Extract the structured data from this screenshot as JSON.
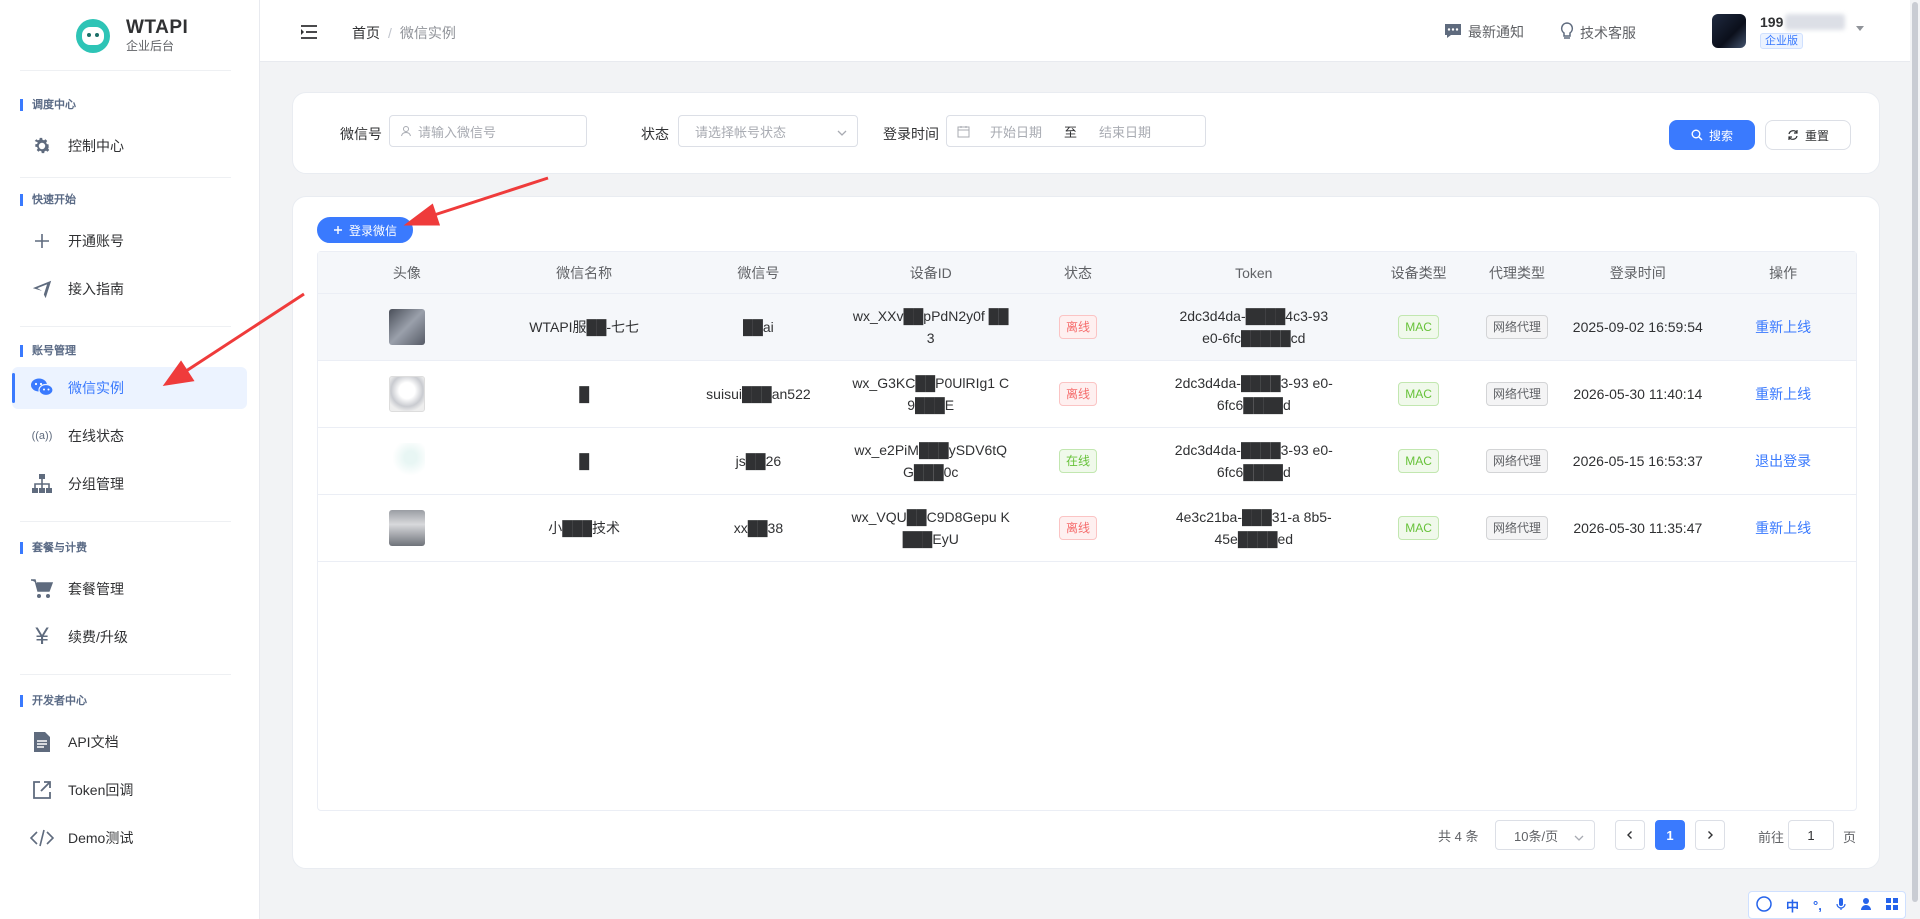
{
  "brand": {
    "title": "WTAPI",
    "subtitle": "企业后台"
  },
  "sidebar": {
    "sections": [
      {
        "title": "调度中心",
        "items": [
          {
            "label": "控制中心",
            "icon": "gear-icon"
          }
        ]
      },
      {
        "title": "快速开始",
        "items": [
          {
            "label": "开通账号",
            "icon": "plus-icon"
          },
          {
            "label": "接入指南",
            "icon": "send-icon"
          }
        ]
      },
      {
        "title": "账号管理",
        "items": [
          {
            "label": "微信实例",
            "icon": "wechat-icon",
            "active": true
          },
          {
            "label": "在线状态",
            "icon": "signal-icon"
          },
          {
            "label": "分组管理",
            "icon": "org-chart-icon"
          }
        ]
      },
      {
        "title": "套餐与计费",
        "items": [
          {
            "label": "套餐管理",
            "icon": "cart-icon"
          },
          {
            "label": "续费/升级",
            "icon": "yen-icon"
          }
        ]
      },
      {
        "title": "开发者中心",
        "items": [
          {
            "label": "API文档",
            "icon": "document-icon"
          },
          {
            "label": "Token回调",
            "icon": "external-link-icon"
          },
          {
            "label": "Demo测试",
            "icon": "code-icon"
          }
        ]
      }
    ]
  },
  "header": {
    "breadcrumb": {
      "home": "首页",
      "sep": "/",
      "current": "微信实例"
    },
    "notify": "最新通知",
    "support": "技术客服",
    "user": {
      "name": "199",
      "tag": "企业版"
    }
  },
  "filter": {
    "wechat_label": "微信号",
    "wechat_placeholder": "请输入微信号",
    "status_label": "状态",
    "status_placeholder": "请选择帐号状态",
    "time_label": "登录时间",
    "start_placeholder": "开始日期",
    "to": "至",
    "end_placeholder": "结束日期",
    "search": "搜索",
    "reset": "重置"
  },
  "table": {
    "login_button": "登录微信",
    "columns": [
      "头像",
      "微信名称",
      "微信号",
      "设备ID",
      "状态",
      "Token",
      "设备类型",
      "代理类型",
      "登录时间",
      "操作"
    ],
    "rows": [
      {
        "name": "WTAPI服██-七七",
        "wxid": "██ai",
        "device": "wx_XXv██pPdN2y0f ██3",
        "status": "离线",
        "status_type": "off",
        "token": "2dc3d4da-████4c3-93 e0-6fc█████cd",
        "device_type": "MAC",
        "proxy": "网络代理",
        "time": "2025-09-02 16:59:54",
        "action": "重新上线",
        "highlight": true
      },
      {
        "name": "█",
        "wxid": "suisui███an522",
        "device": "wx_G3KC██P0UlRIg1 C9███E",
        "status": "离线",
        "status_type": "off",
        "token": "2dc3d4da-████3-93 e0-6fc6████d",
        "device_type": "MAC",
        "proxy": "网络代理",
        "time": "2026-05-30 11:40:14",
        "action": "重新上线",
        "highlight": false
      },
      {
        "name": "█",
        "wxid": "js██26",
        "device": "wx_e2PiM███ySDV6tQ G███0c",
        "status": "在线",
        "status_type": "on",
        "token": "2dc3d4da-████3-93 e0-6fc6████d",
        "device_type": "MAC",
        "proxy": "网络代理",
        "time": "2026-05-15 16:53:37",
        "action": "退出登录",
        "highlight": false
      },
      {
        "name": "小███技术",
        "wxid": "xx██38",
        "device": "wx_VQU██C9D8Gepu K███EyU",
        "status": "离线",
        "status_type": "off",
        "token": "4e3c21ba-███31-a 8b5-45e████ed",
        "device_type": "MAC",
        "proxy": "网络代理",
        "time": "2026-05-30 11:35:47",
        "action": "重新上线",
        "highlight": false
      }
    ]
  },
  "pagination": {
    "total": "共 4 条",
    "size": "10条/页",
    "page": "1",
    "goto": "前往",
    "goto_value": "1",
    "page_unit": "页"
  },
  "ime": {
    "lang": "中"
  }
}
